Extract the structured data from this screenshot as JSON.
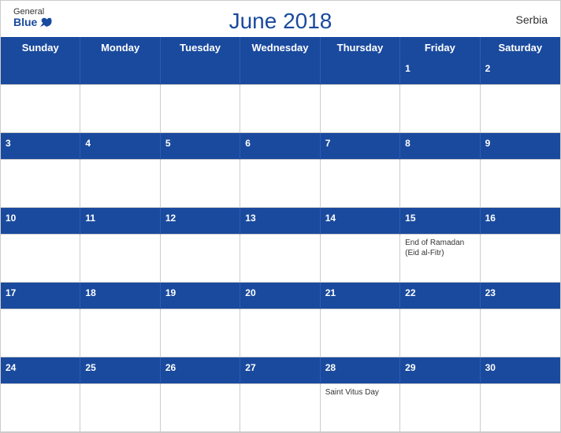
{
  "header": {
    "title": "June 2018",
    "country": "Serbia",
    "logo_general": "General",
    "logo_blue": "Blue"
  },
  "days": [
    "Sunday",
    "Monday",
    "Tuesday",
    "Wednesday",
    "Thursday",
    "Friday",
    "Saturday"
  ],
  "weeks": [
    {
      "dates": [
        "",
        "",
        "",
        "",
        "",
        "1",
        "2"
      ],
      "events": [
        "",
        "",
        "",
        "",
        "",
        "",
        ""
      ]
    },
    {
      "dates": [
        "3",
        "4",
        "5",
        "6",
        "7",
        "8",
        "9"
      ],
      "events": [
        "",
        "",
        "",
        "",
        "",
        "",
        ""
      ]
    },
    {
      "dates": [
        "10",
        "11",
        "12",
        "13",
        "14",
        "15",
        "16"
      ],
      "events": [
        "",
        "",
        "",
        "",
        "",
        "End of Ramadan\n(Eid al-Fitr)",
        ""
      ]
    },
    {
      "dates": [
        "17",
        "18",
        "19",
        "20",
        "21",
        "22",
        "23"
      ],
      "events": [
        "",
        "",
        "",
        "",
        "",
        "",
        ""
      ]
    },
    {
      "dates": [
        "24",
        "25",
        "26",
        "27",
        "28",
        "29",
        "30"
      ],
      "events": [
        "",
        "",
        "",
        "",
        "Saint Vitus Day",
        "",
        ""
      ]
    }
  ]
}
